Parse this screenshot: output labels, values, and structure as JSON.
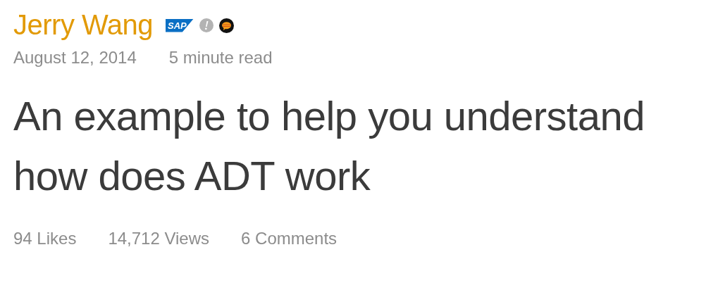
{
  "author": {
    "name": "Jerry Wang",
    "company_logo": "SAP"
  },
  "meta": {
    "date": "August 12, 2014",
    "read_time": "5 minute read"
  },
  "title": "An example to help you understand how does ADT work",
  "stats": [
    "94 Likes",
    "14,712 Views",
    "6 Comments"
  ]
}
